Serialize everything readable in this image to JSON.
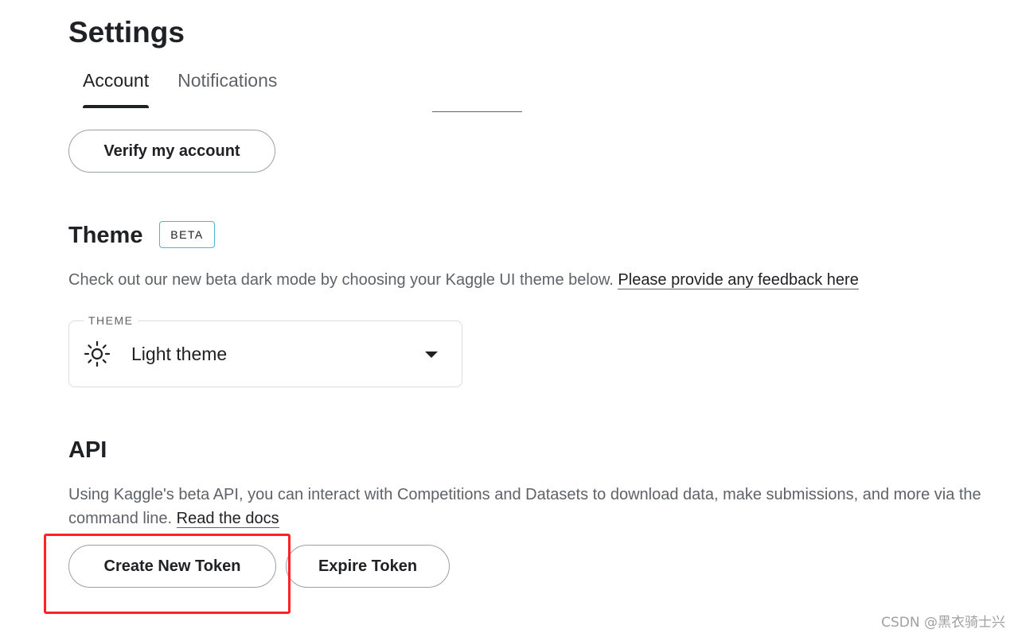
{
  "header": {
    "title": "Settings",
    "tabs": [
      {
        "label": "Account",
        "active": true
      },
      {
        "label": "Notifications",
        "active": false
      }
    ]
  },
  "verify": {
    "button_label": "Verify my account"
  },
  "theme": {
    "title": "Theme",
    "badge": "BETA",
    "description": "Check out our new beta dark mode by choosing your Kaggle UI theme below.",
    "feedback_link": "Please provide any feedback here",
    "select": {
      "legend": "THEME",
      "value": "Light theme",
      "icon": "sun-icon"
    }
  },
  "api": {
    "title": "API",
    "description": "Using Kaggle's beta API, you can interact with Competitions and Datasets to download data, make submissions, and more via the command line.",
    "docs_link": "Read the docs",
    "create_button": "Create New Token",
    "expire_button": "Expire Token"
  },
  "annotation": {
    "highlight_color": "#ff2222"
  },
  "watermark": "CSDN @黑衣骑士兴"
}
